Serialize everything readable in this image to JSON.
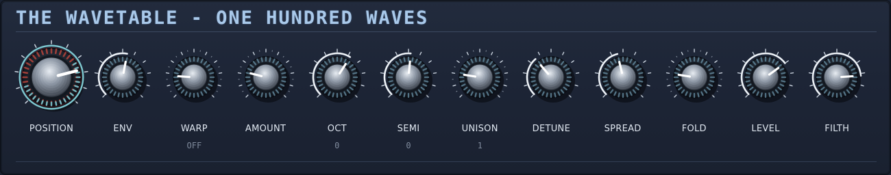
{
  "title": "THE WAVETABLE - ONE HUNDRED WAVES",
  "colors": {
    "accent": "#a9c9ea",
    "arc": "#eef3f8",
    "position_ring": "#7ec7cf",
    "position_red": "#b0322c",
    "ring_blue": "#5f8397"
  },
  "knobs": [
    {
      "id": "position",
      "label": "POSITION",
      "value_text": "",
      "level": 0.78,
      "arc": false,
      "big": true,
      "icon": "position-knob-icon"
    },
    {
      "id": "env",
      "label": "ENV",
      "value_text": "",
      "level": 0.54,
      "arc": true,
      "arc_start": 0.0,
      "big": false,
      "icon": "env-knob-icon"
    },
    {
      "id": "warp",
      "label": "WARP",
      "value_text": "OFF",
      "level": 0.18,
      "arc": false,
      "big": false,
      "icon": "warp-knob-icon"
    },
    {
      "id": "amount",
      "label": "AMOUNT",
      "value_text": "",
      "level": 0.22,
      "arc": false,
      "big": false,
      "icon": "amount-knob-icon"
    },
    {
      "id": "oct",
      "label": "OCT",
      "value_text": "0",
      "level": 0.62,
      "arc": true,
      "arc_start": 0.0,
      "big": false,
      "icon": "oct-knob-icon"
    },
    {
      "id": "semi",
      "label": "SEMI",
      "value_text": "0",
      "level": 0.52,
      "arc": true,
      "arc_start": 0.0,
      "big": false,
      "icon": "semi-knob-icon"
    },
    {
      "id": "unison",
      "label": "UNISON",
      "value_text": "1",
      "level": 0.2,
      "arc": false,
      "big": false,
      "icon": "unison-knob-icon"
    },
    {
      "id": "detune",
      "label": "DETUNE",
      "value_text": "",
      "level": 0.35,
      "arc": true,
      "arc_start": 0.0,
      "big": false,
      "icon": "detune-knob-icon"
    },
    {
      "id": "spread",
      "label": "SPREAD",
      "value_text": "",
      "level": 0.45,
      "arc": true,
      "arc_start": 0.0,
      "big": false,
      "icon": "spread-knob-icon"
    },
    {
      "id": "fold",
      "label": "FOLD",
      "value_text": "",
      "level": 0.2,
      "arc": false,
      "big": false,
      "icon": "fold-knob-icon"
    },
    {
      "id": "level",
      "label": "LEVEL",
      "value_text": "",
      "level": 0.7,
      "arc": true,
      "arc_start": 0.0,
      "big": false,
      "icon": "level-knob-icon"
    },
    {
      "id": "filth",
      "label": "FILTH",
      "value_text": "",
      "level": 0.82,
      "arc": true,
      "arc_start": 0.0,
      "big": false,
      "icon": "filth-knob-icon"
    }
  ]
}
